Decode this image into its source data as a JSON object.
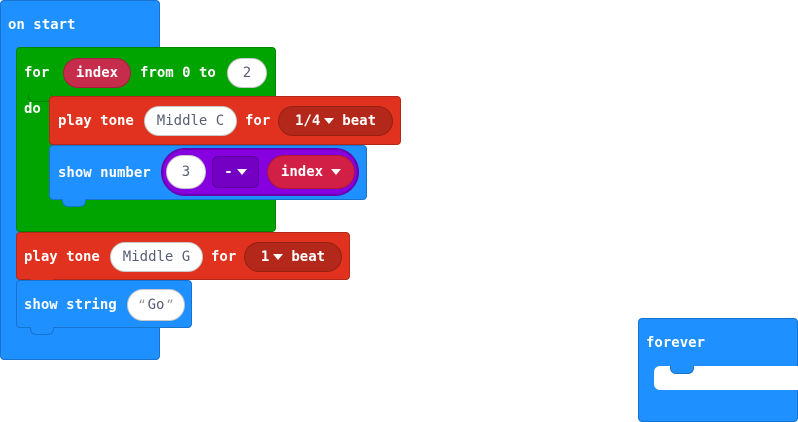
{
  "on_start": {
    "label": "on start"
  },
  "for_loop": {
    "for_label": "for",
    "var": "index",
    "from_label": "from 0 to",
    "to_value": "2",
    "do_label": "do"
  },
  "play_tone_1": {
    "label": "play tone",
    "note": "Middle C",
    "for_label": "for",
    "beat_value": "1/4",
    "beat_label": "beat"
  },
  "show_number": {
    "label": "show number",
    "left": "3",
    "op": "-",
    "right": "index"
  },
  "play_tone_2": {
    "label": "play tone",
    "note": "Middle G",
    "for_label": "for",
    "beat_value": "1",
    "beat_label": "beat"
  },
  "show_string": {
    "label": "show string",
    "value": "Go",
    "open_quote": "“",
    "close_quote": "”"
  },
  "forever": {
    "label": "forever"
  },
  "colors": {
    "basic": "#1e90ff",
    "loops": "#00a400",
    "music": "#e0321f",
    "math": "#8700e0",
    "variables": "#d21f45"
  }
}
